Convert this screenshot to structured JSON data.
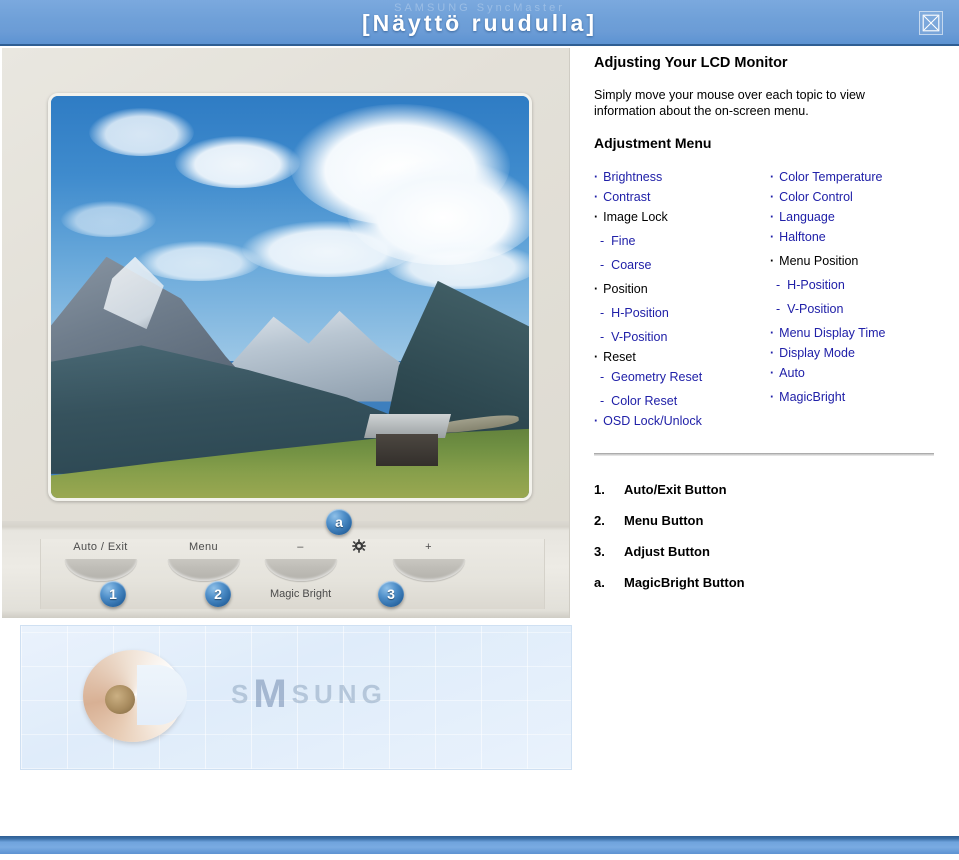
{
  "header": {
    "title": "[Näyttö ruudulla]",
    "ghost_text": "SAMSUNG      SyncMaster",
    "close_icon": "close-icon"
  },
  "monitor": {
    "screen_image": "mountain-landscape-photo",
    "controls": [
      {
        "label": "Auto / Exit",
        "badge": "1",
        "sub": ""
      },
      {
        "label": "Menu",
        "badge": "2",
        "sub": ""
      },
      {
        "label": "–",
        "badge": "a",
        "sub": "Magic Bright"
      },
      {
        "label": "gear-icon",
        "badge": "",
        "sub": ""
      },
      {
        "label": "+",
        "badge": "3",
        "sub": ""
      }
    ],
    "magic_bright_label": "Magic Bright"
  },
  "shell_panel": {
    "shell_icon": "nautilus-shell",
    "brand_prefix": "S",
    "brand_mark": "M",
    "brand_suffix": "SUNG"
  },
  "content": {
    "doc_title": "Adjusting Your LCD Monitor",
    "intro": "Simply move your mouse over each topic to view information about the on-screen menu.",
    "menu_title": "Adjustment Menu",
    "left_column": [
      {
        "label": "Brightness",
        "level": 1,
        "link": true,
        "gap": false
      },
      {
        "label": "Contrast",
        "level": 1,
        "link": true,
        "gap": false
      },
      {
        "label": "Image Lock",
        "level": 1,
        "link": false,
        "gap": false
      },
      {
        "label": "Fine",
        "level": 2,
        "link": true,
        "gap": true
      },
      {
        "label": "Coarse",
        "level": 2,
        "link": true,
        "gap": true
      },
      {
        "label": "Position",
        "level": 1,
        "link": false,
        "gap": true
      },
      {
        "label": "H-Position",
        "level": 2,
        "link": true,
        "gap": true
      },
      {
        "label": "V-Position",
        "level": 2,
        "link": true,
        "gap": true
      },
      {
        "label": "Reset",
        "level": 1,
        "link": false,
        "gap": false
      },
      {
        "label": "Geometry Reset",
        "level": 2,
        "link": true,
        "gap": false
      },
      {
        "label": "Color Reset",
        "level": 2,
        "link": true,
        "gap": true
      },
      {
        "label": "OSD Lock/Unlock",
        "level": 1,
        "link": true,
        "gap": false
      }
    ],
    "right_column": [
      {
        "label": "Color Temperature",
        "level": 1,
        "link": true,
        "gap": false
      },
      {
        "label": "Color Control",
        "level": 1,
        "link": true,
        "gap": false
      },
      {
        "label": "Language",
        "level": 1,
        "link": true,
        "gap": false
      },
      {
        "label": "Halftone",
        "level": 1,
        "link": true,
        "gap": false
      },
      {
        "label": "Menu Position",
        "level": 1,
        "link": false,
        "gap": true
      },
      {
        "label": "H-Position",
        "level": 2,
        "link": true,
        "gap": true
      },
      {
        "label": "V-Position",
        "level": 2,
        "link": true,
        "gap": true
      },
      {
        "label": "Menu Display Time",
        "level": 1,
        "link": true,
        "gap": true
      },
      {
        "label": "Display Mode",
        "level": 1,
        "link": true,
        "gap": false
      },
      {
        "label": "Auto",
        "level": 1,
        "link": true,
        "gap": false
      },
      {
        "label": "MagicBright",
        "level": 1,
        "link": true,
        "gap": true
      }
    ],
    "numbered_list": [
      {
        "num": "1.",
        "label": "Auto/Exit Button"
      },
      {
        "num": "2.",
        "label": "Menu Button"
      },
      {
        "num": "3.",
        "label": "Adjust Button"
      },
      {
        "num": "a.",
        "label": "MagicBright Button"
      }
    ]
  },
  "colors": {
    "header_blue": "#6fa3dd",
    "link_blue": "#2020a8",
    "badge_blue": "#2c6aa6",
    "bezel": "#e3e0d8"
  }
}
